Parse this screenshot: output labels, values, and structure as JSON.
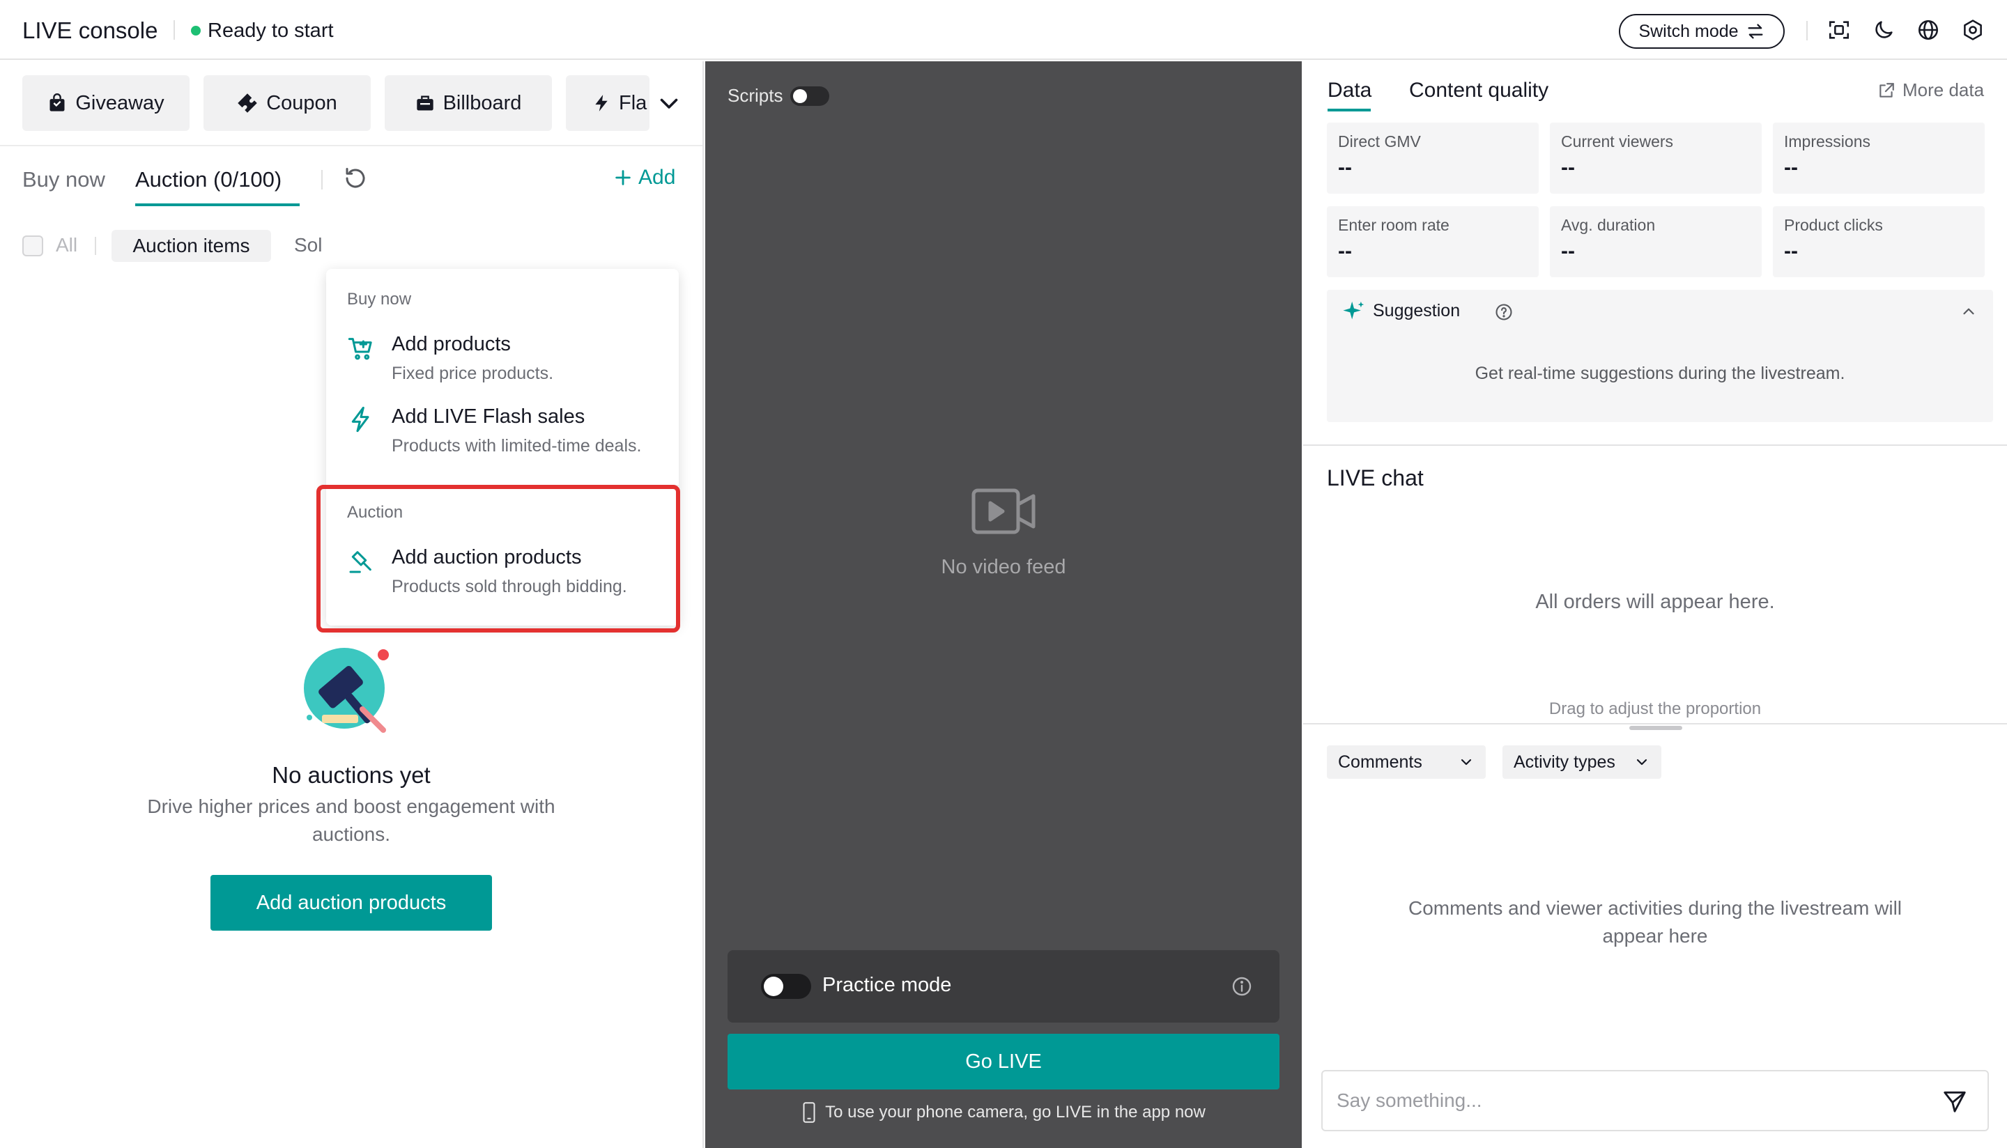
{
  "header": {
    "title": "LIVE console",
    "status": "Ready to start",
    "status_color": "#1dbf73",
    "switch_mode_label": "Switch mode",
    "icons": [
      "fullscreen-icon",
      "moon-icon",
      "globe-icon",
      "settings-icon"
    ]
  },
  "toolbar": {
    "giveaway": "Giveaway",
    "coupon": "Coupon",
    "billboard": "Billboard",
    "flash_partial": "Fla"
  },
  "tabs": {
    "buy_now": "Buy now",
    "auction": "Auction (0/100)",
    "add": "Add"
  },
  "filters": {
    "all": "All",
    "auction_items": "Auction items",
    "sold_partial": "Sol"
  },
  "dropdown": {
    "buy_now_section": "Buy now",
    "add_products_title": "Add products",
    "add_products_desc": "Fixed price products.",
    "flash_title": "Add LIVE Flash sales",
    "flash_desc": "Products with limited-time deals.",
    "auction_section": "Auction",
    "auction_title": "Add auction products",
    "auction_desc": "Products sold through bidding."
  },
  "empty_state": {
    "title": "No auctions yet",
    "description": "Drive higher prices and boost engagement with auctions.",
    "button": "Add auction products"
  },
  "video": {
    "scripts_label": "Scripts",
    "no_video": "No video feed",
    "practice_mode": "Practice mode",
    "go_live": "Go LIVE",
    "phone_hint": "To use your phone camera, go LIVE in the app now"
  },
  "data_panel": {
    "tab_data": "Data",
    "tab_quality": "Content quality",
    "more_data": "More data",
    "metrics": [
      {
        "label": "Direct GMV",
        "value": "--"
      },
      {
        "label": "Current viewers",
        "value": "--"
      },
      {
        "label": "Impressions",
        "value": "--"
      },
      {
        "label": "Enter room rate",
        "value": "--"
      },
      {
        "label": "Avg. duration",
        "value": "--"
      },
      {
        "label": "Product clicks",
        "value": "--"
      }
    ],
    "suggestion_title": "Suggestion",
    "suggestion_text": "Get real-time suggestions during the livestream."
  },
  "chat": {
    "title": "LIVE chat",
    "orders_placeholder": "All orders will appear here.",
    "drag_hint": "Drag to adjust the proportion",
    "comments_select": "Comments",
    "activity_select": "Activity types",
    "comments_placeholder": "Comments and viewer activities during the livestream will appear here",
    "input_placeholder": "Say something..."
  },
  "colors": {
    "accent": "#009995",
    "highlight": "#e3302f",
    "video_bg": "#4d4d4f"
  }
}
